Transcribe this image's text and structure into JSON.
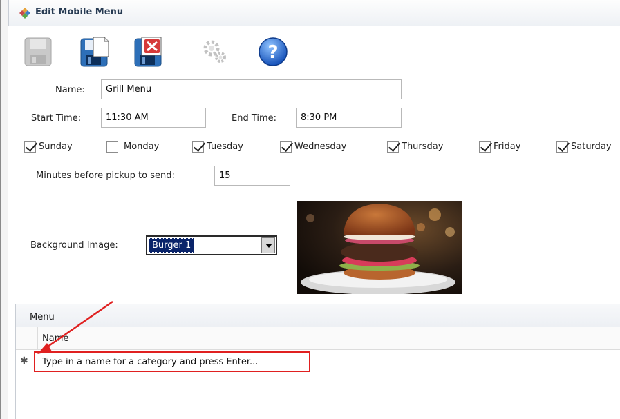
{
  "window": {
    "title": "Edit Mobile Menu"
  },
  "toolbar": {
    "buttons": [
      {
        "icon": "floppy-disk-icon",
        "state": "disabled"
      },
      {
        "icon": "save-new-icon",
        "state": "enabled"
      },
      {
        "icon": "save-close-icon",
        "state": "enabled"
      },
      {
        "icon": "gears-icon",
        "state": "disabled"
      },
      {
        "icon": "help-icon",
        "state": "enabled"
      }
    ]
  },
  "form": {
    "name_label": "Name:",
    "name_value": "Grill Menu",
    "start_label": "Start Time:",
    "start_value": "11:30 AM",
    "end_label": "End Time:",
    "end_value": "8:30 PM",
    "days": [
      {
        "label": "Sunday",
        "checked": true
      },
      {
        "label": "Monday",
        "checked": false
      },
      {
        "label": "Tuesday",
        "checked": true
      },
      {
        "label": "Wednesday",
        "checked": true
      },
      {
        "label": "Thursday",
        "checked": true
      },
      {
        "label": "Friday",
        "checked": true
      },
      {
        "label": "Saturday",
        "checked": true
      }
    ],
    "minutes_label": "Minutes before pickup to send:",
    "minutes_value": "15",
    "bg_label": "Background Image:",
    "bg_selected": "Burger 1"
  },
  "menu": {
    "header": "Menu",
    "column_name": "Name",
    "new_row_marker": "✱",
    "new_row_placeholder": "Type in a name for a category and press Enter..."
  },
  "colors": {
    "annotation": "#e02020",
    "selection": "#0a246a"
  }
}
